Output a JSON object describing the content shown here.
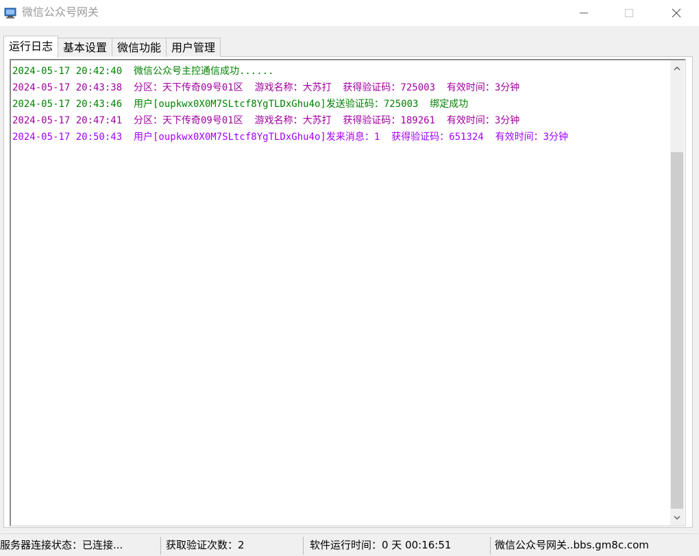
{
  "window": {
    "title": "微信公众号网关",
    "icon": "window-app-icon",
    "controls": {
      "minimize": "—",
      "maximize": "☐",
      "close": "✕"
    }
  },
  "tabs": [
    {
      "label": "运行日志",
      "active": true
    },
    {
      "label": "基本设置",
      "active": false
    },
    {
      "label": "微信功能",
      "active": false
    },
    {
      "label": "用户管理",
      "active": false
    }
  ],
  "colors": {
    "log_green": "#008000",
    "log_purple": "#a000a0",
    "log_violet": "#a000ff"
  },
  "log": [
    {
      "text": "2024-05-17 20:42:40  微信公众号主控通信成功......",
      "color": "green"
    },
    {
      "text": "2024-05-17 20:43:38  分区：天下传奇09号01区  游戏名称：大苏打  获得验证码：725003  有效时间：3分钟",
      "color": "purple"
    },
    {
      "text": "2024-05-17 20:43:46  用户[oupkwx0X0M7SLtcf8YgTLDxGhu4o]发送验证码：725003  绑定成功",
      "color": "green"
    },
    {
      "text": "2024-05-17 20:47:41  分区：天下传奇09号01区  游戏名称：大苏打  获得验证码：189261  有效时间：3分钟",
      "color": "purple"
    },
    {
      "text": "2024-05-17 20:50:43  用户[oupkwx0X0M7SLtcf8YgTLDxGhu4o]发来消息：1  获得验证码：651324  有效时间：3分钟",
      "color": "violet"
    }
  ],
  "status": {
    "connection": "服务器连接状态：已连接...",
    "verify_count": "获取验证次数：2",
    "uptime": "软件运行时间：0 天 00:16:51",
    "site": "微信公众号网关..bbs.gm8c.com"
  },
  "scrollbar": {
    "up_glyph": "▲",
    "down_glyph": "▼"
  }
}
